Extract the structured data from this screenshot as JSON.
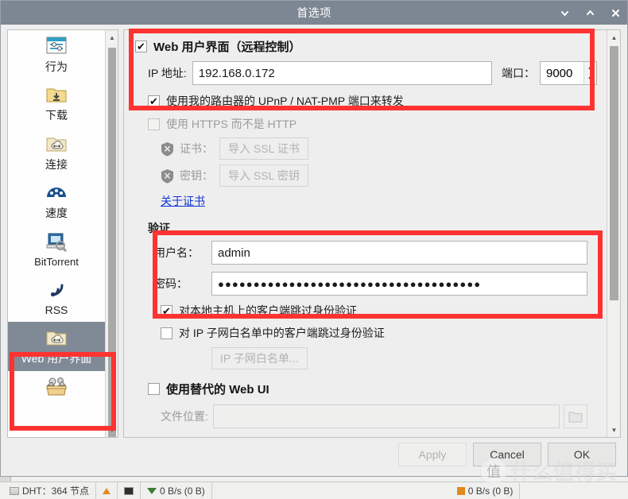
{
  "window": {
    "title": "首选项",
    "buttons": [
      {
        "name": "minimize",
        "glyph": "chevron-down-icon"
      },
      {
        "name": "maximize",
        "glyph": "chevron-up-icon"
      },
      {
        "name": "close",
        "glyph": "close-icon"
      }
    ]
  },
  "sidebar": {
    "items": [
      {
        "label": "行为",
        "icon": "behavior-icon",
        "selected": false
      },
      {
        "label": "下载",
        "icon": "download-icon",
        "selected": false
      },
      {
        "label": "连接",
        "icon": "connection-icon",
        "selected": false
      },
      {
        "label": "速度",
        "icon": "speed-icon",
        "selected": false
      },
      {
        "label": "BitTorrent",
        "icon": "bittorrent-icon",
        "selected": false
      },
      {
        "label": "RSS",
        "icon": "rss-icon",
        "selected": false
      },
      {
        "label": "Web 用户界面",
        "icon": "webui-icon",
        "selected": true
      },
      {
        "label": "",
        "icon": "advanced-icon",
        "selected": false
      }
    ]
  },
  "main": {
    "webui": {
      "checkbox_label": "Web 用户界面（远程控制）",
      "checked": true,
      "ip_label": "IP 地址:",
      "ip_value": "192.168.0.172",
      "port_label": "端口：",
      "port_value": "9000",
      "upnp_label": "使用我的路由器的 UPnP / NAT-PMP 端口来转发",
      "upnp_checked": true
    },
    "https": {
      "checkbox_label": "使用 HTTPS 而不是 HTTP",
      "checked": false,
      "cert_label": "证书：",
      "cert_button": "导入 SSL 证书",
      "key_label": "密钥：",
      "key_button": "导入 SSL 密钥",
      "about_link": "关于证书"
    },
    "auth": {
      "header": "验证",
      "username_label": "用户名：",
      "username_value": "admin",
      "password_label": "密码：",
      "password_value": "●●●●●●●●●●●●●●●●●●●●●●●●●●●●●●●●●●●●●",
      "bypass_localhost_label": "对本地主机上的客户端跳过身份验证",
      "bypass_localhost_checked": true,
      "bypass_subnet_label": "对 IP 子网白名单中的客户端跳过身份验证",
      "bypass_subnet_checked": false,
      "subnet_button": "IP 子网白名单..."
    },
    "alt_webui": {
      "checkbox_label": "使用替代的 Web UI",
      "checked": false,
      "file_label": "文件位置:",
      "file_value": "",
      "browse_icon": "folder-icon"
    }
  },
  "footer": {
    "apply": "Apply",
    "cancel": "Cancel",
    "ok": "OK"
  },
  "background": {
    "status": [
      {
        "icon": "dht-icon",
        "text": "DHT：364 节点"
      },
      {
        "icon": "upload-icon",
        "text": ""
      },
      {
        "icon": "disk-icon",
        "text": ""
      },
      {
        "icon": "download-rate-icon",
        "text": "0 B/s (0 B)"
      },
      {
        "icon": "upload-rate-icon",
        "text": "0 B/s (0 B)"
      }
    ]
  },
  "watermark": {
    "logo": "值",
    "text": "什么值得买"
  },
  "colors": {
    "titlebar": "#7d8793",
    "annotation": "#fc3331",
    "selection": "#808a96",
    "link": "#0d34d6"
  }
}
